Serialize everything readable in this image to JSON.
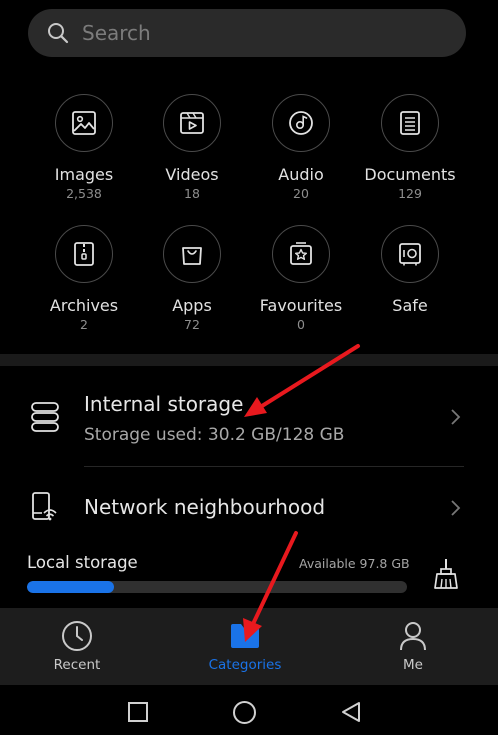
{
  "search": {
    "placeholder": "Search"
  },
  "categories": [
    {
      "label": "Images",
      "count": "2,538",
      "icon": "image-icon"
    },
    {
      "label": "Videos",
      "count": "18",
      "icon": "video-icon"
    },
    {
      "label": "Audio",
      "count": "20",
      "icon": "music-disc-icon"
    },
    {
      "label": "Documents",
      "count": "129",
      "icon": "document-icon"
    },
    {
      "label": "Archives",
      "count": "2",
      "icon": "archive-zip-icon"
    },
    {
      "label": "Apps",
      "count": "72",
      "icon": "shopping-bag-icon"
    },
    {
      "label": "Favourites",
      "count": "0",
      "icon": "star-icon"
    },
    {
      "label": "Safe",
      "count": "",
      "icon": "safe-icon"
    }
  ],
  "storage": {
    "internal_title": "Internal storage",
    "internal_used": "Storage used: 30.2 GB/128 GB",
    "network_title": "Network neighbourhood",
    "local_title": "Local storage",
    "local_available": "Available 97.8 GB",
    "local_used_fraction": 0.23
  },
  "bottom_nav": {
    "recent": "Recent",
    "categories": "Categories",
    "me": "Me"
  },
  "colors": {
    "accent": "#1a73e8",
    "annotation_arrow": "#e8191e"
  }
}
